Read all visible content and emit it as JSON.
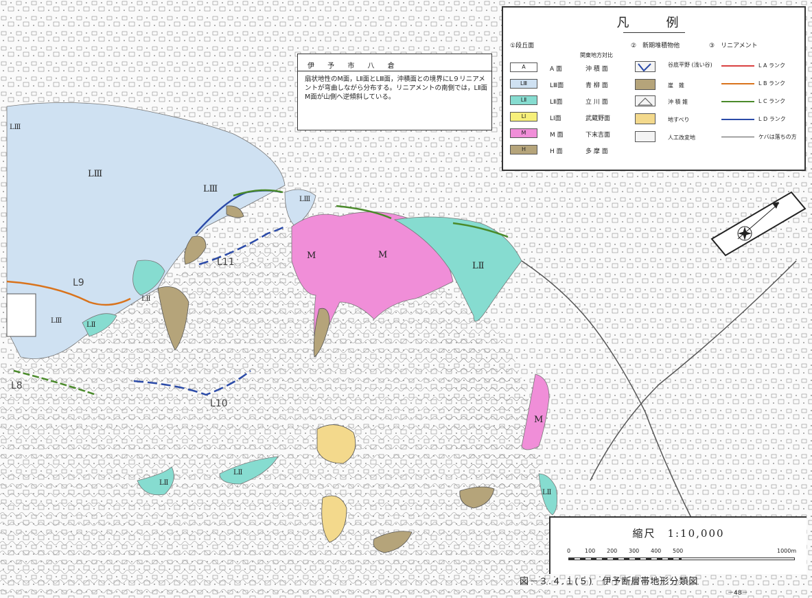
{
  "legend": {
    "title": "凡　例",
    "terrace_head": "①段丘面",
    "kanto_head": "関東地方対比",
    "deposit_head": "②　新期堆積物他",
    "lineament_head": "③　リニアメント",
    "terraces": [
      {
        "code": "A",
        "name": "A 面",
        "kanto": "沖 積 面",
        "color": "#ffffff"
      },
      {
        "code": "LⅢ",
        "name": "LⅢ面",
        "kanto": "青 柳 面",
        "color": "#cfe1f2"
      },
      {
        "code": "LⅡ",
        "name": "LⅡ面",
        "kanto": "立 川 面",
        "color": "#86dcd0"
      },
      {
        "code": "LⅠ",
        "name": "LⅠ面",
        "kanto": "武蔵野面",
        "color": "#f6ef7a"
      },
      {
        "code": "M",
        "name": "M 面",
        "kanto": "下末吉面",
        "color": "#f08ed8"
      },
      {
        "code": "H",
        "name": "H 面",
        "kanto": "多 摩 面",
        "color": "#b5a47a"
      }
    ],
    "deposits": [
      {
        "label": "谷底平野\n(浅い谷)",
        "icon": "valley-plain-icon"
      },
      {
        "label": "崖　錐",
        "icon": "talus-icon"
      },
      {
        "label": "沖 積 錐",
        "icon": "alluvial-cone-icon"
      },
      {
        "label": "地すべり",
        "icon": "landslide-icon"
      },
      {
        "label": "人工改変地",
        "icon": "artificial-land-icon"
      }
    ],
    "lineaments": [
      {
        "label": "L A ランク",
        "color": "#d94040"
      },
      {
        "label": "L B ランク",
        "color": "#d9731c"
      },
      {
        "label": "L C ランク",
        "color": "#4a8a2a"
      },
      {
        "label": "L D ランク",
        "color": "#2a4aa8"
      },
      {
        "label": "ケバは落ちの方",
        "color": "#555555"
      }
    ]
  },
  "note": {
    "title": "伊 予 市 八 倉",
    "body": "扇状地性のM面，LⅡ面とLⅢ面，沖積面との境界にL９リニアメントが弯曲しながら分布する。リニアメントの南側では，LⅡ面M面が山側へ逆傾斜している。"
  },
  "scale": {
    "title": "縮尺　1:10,000",
    "ticks": [
      "0",
      "100",
      "200",
      "300",
      "400",
      "500",
      "1000m"
    ]
  },
  "caption": "図－３.４.１(５)　伊予断層帯地形分類図",
  "page_number": "－48－",
  "map_labels": {
    "l3_a": "LⅢ",
    "l3_b": "LⅢ",
    "l3_c": "LⅢ",
    "l3_d": "LⅢ",
    "l3_e": "LⅢ",
    "m_a": "M",
    "m_b": "M",
    "m_c": "M",
    "l2_a": "LⅡ",
    "l2_b": "LⅡ",
    "l2_c": "LⅡ",
    "l2_d": "LⅡ",
    "l2_e": "LⅡ",
    "l2_f": "LⅡ",
    "l9": "L9",
    "l8": "L8",
    "l10": "L10",
    "l11": "L11"
  }
}
